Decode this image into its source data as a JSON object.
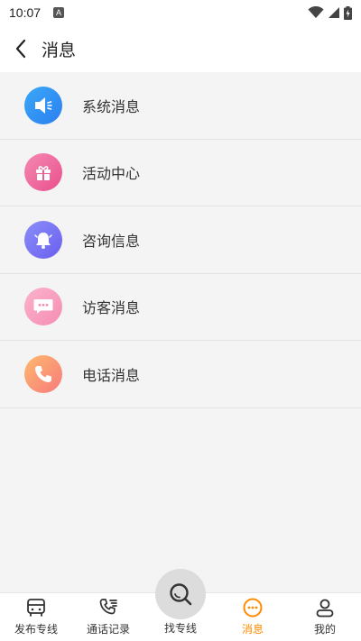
{
  "status_bar": {
    "time": "10:07",
    "indicator": "A"
  },
  "header": {
    "title": "消息",
    "back_icon": "chevron-left-icon"
  },
  "items": [
    {
      "label": "系统消息",
      "icon": "speaker-icon",
      "colors": [
        "#3aa8f7",
        "#2b7ff0"
      ]
    },
    {
      "label": "活动中心",
      "icon": "gift-icon",
      "colors": [
        "#f48ab2",
        "#ea4f8c"
      ]
    },
    {
      "label": "咨询信息",
      "icon": "bell-icon",
      "colors": [
        "#8a8ef8",
        "#6a5ff0"
      ]
    },
    {
      "label": "访客消息",
      "icon": "chat-bubble-icon",
      "colors": [
        "#fbb3cc",
        "#f58db2"
      ]
    },
    {
      "label": "电话消息",
      "icon": "phone-icon",
      "colors": [
        "#fdb96c",
        "#f87a7e"
      ]
    }
  ],
  "tabs": [
    {
      "label": "发布专线",
      "icon": "bus-icon"
    },
    {
      "label": "通话记录",
      "icon": "call-log-icon"
    },
    {
      "label": "找专线",
      "icon": "search-icon"
    },
    {
      "label": "消息",
      "icon": "message-icon",
      "active": true
    },
    {
      "label": "我的",
      "icon": "user-icon"
    }
  ],
  "accent_color": "#ff8a00"
}
